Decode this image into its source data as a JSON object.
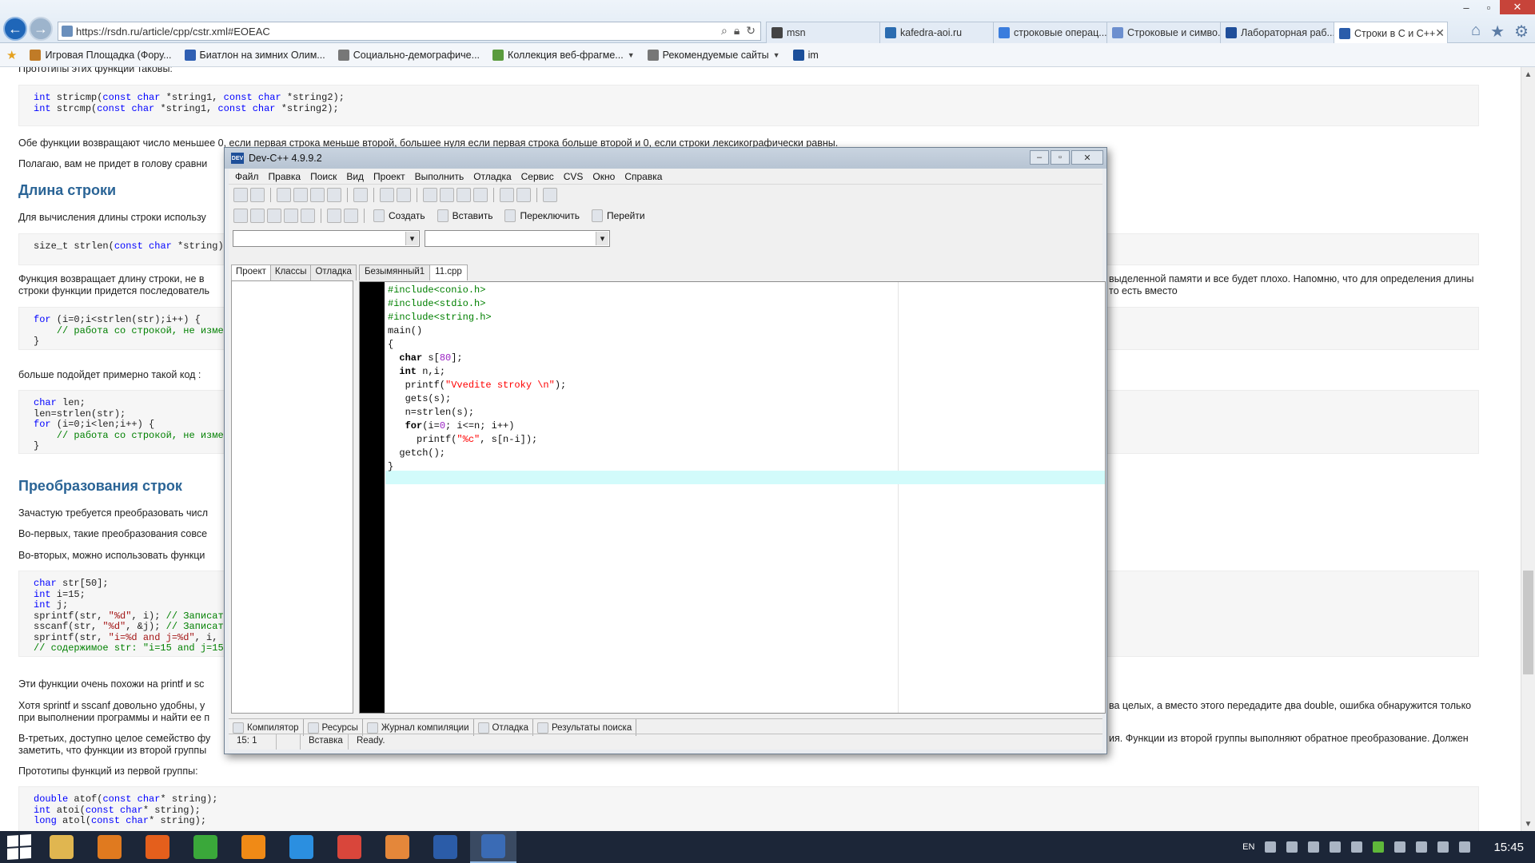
{
  "browser": {
    "url": "https://rsdn.ru/article/cpp/cstr.xml#EOEAC",
    "tabs": [
      {
        "label": "msn",
        "color": "#444"
      },
      {
        "label": "kafedra-aoi.ru",
        "color": "#2b6cb0"
      },
      {
        "label": "строковые операц...",
        "color": "#3b7ddd"
      },
      {
        "label": "Строковые и симво...",
        "color": "#6c8fcf"
      },
      {
        "label": "Лабораторная раб...",
        "color": "#1f4e9a"
      },
      {
        "label": "Строки в С и С++",
        "color": "#2a5caa",
        "active": true
      }
    ],
    "close_tab": "✕",
    "favorites": [
      {
        "label": "Игровая Площадка (Фору...",
        "color": "#c07b27"
      },
      {
        "label": "Биатлон на зимних Олим...",
        "color": "#2f5fb3"
      },
      {
        "label": "Социально-демографиче...",
        "color": "#777"
      },
      {
        "label": "Коллекция веб-фрагме...",
        "color": "#5a9b3d",
        "dropdown": true
      },
      {
        "label": "Рекомендуемые сайты",
        "color": "#777",
        "dropdown": true
      },
      {
        "label": "im",
        "color": "#1b4f9a"
      }
    ],
    "fav_star": "★"
  },
  "article": {
    "p_prototypes": "Прототипы этих функций таковы:",
    "code1": [
      [
        {
          "t": "int",
          "k": "kw"
        },
        {
          "t": " stricmp("
        },
        {
          "t": "const",
          "k": "kw"
        },
        {
          "t": " "
        },
        {
          "t": "char",
          "k": "kw"
        },
        {
          "t": " *string1, "
        },
        {
          "t": "const",
          "k": "kw"
        },
        {
          "t": " "
        },
        {
          "t": "char",
          "k": "kw"
        },
        {
          "t": " *string2);"
        }
      ],
      [
        {
          "t": "int",
          "k": "kw"
        },
        {
          "t": " strcmp("
        },
        {
          "t": "const",
          "k": "kw"
        },
        {
          "t": " "
        },
        {
          "t": "char",
          "k": "kw"
        },
        {
          "t": " *string1, "
        },
        {
          "t": "const",
          "k": "kw"
        },
        {
          "t": " "
        },
        {
          "t": "char",
          "k": "kw"
        },
        {
          "t": " *string2);"
        }
      ]
    ],
    "p_both": "Обе функции возвращают число меньшее 0, если первая строка меньше второй, большее нуля если первая строка больше второй и 0, если строки лексикографически равны.",
    "p_guess": "Полагаю, вам не придет в голову сравни",
    "h_length": "Длина строки",
    "p_length": "Для вычисления длины строки использу",
    "code2": [
      [
        {
          "t": "size_t strlen("
        },
        {
          "t": "const",
          "k": "kw"
        },
        {
          "t": " "
        },
        {
          "t": "char",
          "k": "kw"
        },
        {
          "t": " *string);"
        }
      ]
    ],
    "p_returns_a": "Функция возвращает длину строки, не в",
    "p_returns_a_right": "выделенной памяти и все будет плохо. Напомню, что для определения длины",
    "p_returns_b": "строки функции придется последователь",
    "p_returns_b_right": "то есть вместо",
    "code3": [
      [
        {
          "t": "for",
          "k": "kw"
        },
        {
          "t": " (i=0;i<strlen(str);i++) {"
        }
      ],
      [
        {
          "t": "    "
        },
        {
          "t": "// работа со строкой, не изме",
          "k": "cm"
        }
      ],
      [
        {
          "t": "}"
        }
      ]
    ],
    "p_better": "больше подойдет примерно такой код :",
    "code4": [
      [
        {
          "t": "char",
          "k": "kw"
        },
        {
          "t": " len;"
        }
      ],
      [
        {
          "t": "len=strlen(str);"
        }
      ],
      [
        {
          "t": "for",
          "k": "kw"
        },
        {
          "t": " (i=0;i<len;i++) {"
        }
      ],
      [
        {
          "t": "    "
        },
        {
          "t": "// работа со строкой, не изме",
          "k": "cm"
        }
      ],
      [
        {
          "t": "}"
        }
      ]
    ],
    "h_convert": "Преобразования строк",
    "p_often": "Зачастую требуется преобразовать числ",
    "p_first": "Во-первых, такие преобразования совсе",
    "p_second": "Во-вторых, можно использовать функци",
    "code5": [
      [
        {
          "t": "char",
          "k": "kw"
        },
        {
          "t": " str[50];"
        }
      ],
      [
        {
          "t": "int",
          "k": "kw"
        },
        {
          "t": " i=15;"
        }
      ],
      [
        {
          "t": "int",
          "k": "kw"
        },
        {
          "t": " j;"
        }
      ],
      [
        {
          "t": "sprintf(str, "
        },
        {
          "t": "\"%d\"",
          "k": "st"
        },
        {
          "t": ", i); "
        },
        {
          "t": "// Записат",
          "k": "cm"
        }
      ],
      [
        {
          "t": "sscanf(str, "
        },
        {
          "t": "\"%d\"",
          "k": "st"
        },
        {
          "t": ", &j); "
        },
        {
          "t": "// Записат",
          "k": "cm"
        }
      ],
      [
        {
          "t": "sprintf(str, "
        },
        {
          "t": "\"i=%d and j=%d\"",
          "k": "st"
        },
        {
          "t": ", i,"
        }
      ],
      [
        {
          "t": "// содержимое str: \"i=15 and j=15",
          "k": "cm"
        }
      ]
    ],
    "p_similar": "Эти функции очень похожи на printf и sc",
    "p_though_a": "Хотя sprintf и sscanf довольно удобны, у",
    "p_though_a_right": "ва целых, а вместо этого передадите два double, ошибка обнаружится только",
    "p_though_b": "при выполнении программы и найти ее п",
    "p_third_a": "В-третьих, доступно целое семейство фу",
    "p_third_a_right": "ия. Функции из второй группы выполняют обратное преобразование. Должен",
    "p_third_b": "заметить, что функции из второй группы",
    "p_protos_first": "Прототипы функций из первой группы:",
    "code6": [
      [
        {
          "t": "double",
          "k": "kw"
        },
        {
          "t": " atof("
        },
        {
          "t": "const",
          "k": "kw"
        },
        {
          "t": " "
        },
        {
          "t": "char",
          "k": "kw"
        },
        {
          "t": "* string);"
        }
      ],
      [
        {
          "t": "int",
          "k": "kw"
        },
        {
          "t": " atoi("
        },
        {
          "t": "const",
          "k": "kw"
        },
        {
          "t": " "
        },
        {
          "t": "char",
          "k": "kw"
        },
        {
          "t": "* string);"
        }
      ],
      [
        {
          "t": "long",
          "k": "kw"
        },
        {
          "t": " atol("
        },
        {
          "t": "const",
          "k": "kw"
        },
        {
          "t": " "
        },
        {
          "t": "char",
          "k": "kw"
        },
        {
          "t": "* string);"
        }
      ]
    ]
  },
  "devcpp": {
    "title": "Dev-C++ 4.9.9.2",
    "logo": "DEV",
    "menu": [
      "Файл",
      "Правка",
      "Поиск",
      "Вид",
      "Проект",
      "Выполнить",
      "Отладка",
      "Сервис",
      "CVS",
      "Окно",
      "Справка"
    ],
    "buttons": {
      "create": "Создать",
      "insert": "Вставить",
      "toggle": "Переключить",
      "goto": "Перейти"
    },
    "left_tabs": [
      "Проект",
      "Классы",
      "Отладка"
    ],
    "editor_tabs": [
      "Безымянный1",
      "11.cpp"
    ],
    "code": [
      [
        {
          "t": "#include<conio.h>",
          "k": "pp"
        }
      ],
      [
        {
          "t": "#include<stdio.h>",
          "k": "pp"
        }
      ],
      [
        {
          "t": "#include<string.h>",
          "k": "pp"
        }
      ],
      [
        {
          "t": "main()"
        }
      ],
      [
        {
          "t": "{"
        }
      ],
      [
        {
          "t": "  "
        },
        {
          "t": "char",
          "k": "ks"
        },
        {
          "t": " s["
        },
        {
          "t": "80",
          "k": "num"
        },
        {
          "t": "];"
        }
      ],
      [
        {
          "t": "  "
        },
        {
          "t": "int",
          "k": "ks"
        },
        {
          "t": " n,i;"
        }
      ],
      [
        {
          "t": "   printf("
        },
        {
          "t": "\"Vvedite stroky \\n\"",
          "k": "str"
        },
        {
          "t": ");"
        }
      ],
      [
        {
          "t": "   gets(s);"
        }
      ],
      [
        {
          "t": "   n=strlen(s);"
        }
      ],
      [
        {
          "t": "   "
        },
        {
          "t": "for",
          "k": "ks"
        },
        {
          "t": "(i="
        },
        {
          "t": "0",
          "k": "num"
        },
        {
          "t": "; i<=n; i++)"
        }
      ],
      [
        {
          "t": "     printf("
        },
        {
          "t": "\"%c\"",
          "k": "str"
        },
        {
          "t": ", s[n-i]);"
        }
      ],
      [
        {
          "t": "  getch();"
        }
      ],
      [
        {
          "t": "}"
        }
      ]
    ],
    "bottom_tabs": [
      "Компилятор",
      "Ресурсы",
      "Журнал компиляции",
      "Отладка",
      "Результаты поиска"
    ],
    "status": {
      "pos": "15: 1",
      "mode": "Вставка",
      "state": "Ready."
    }
  },
  "taskbar": {
    "lang": "EN",
    "time": "15:45",
    "apps": [
      {
        "name": "explorer",
        "color": "#e0b650"
      },
      {
        "name": "media-player",
        "color": "#e07a1f"
      },
      {
        "name": "firefox",
        "color": "#e45f1c"
      },
      {
        "name": "a-app",
        "color": "#3aa83a"
      },
      {
        "name": "odnoklassniki",
        "color": "#f08a16"
      },
      {
        "name": "internet-explorer",
        "color": "#2b8fe0"
      },
      {
        "name": "chrome",
        "color": "#d9463b"
      },
      {
        "name": "notes",
        "color": "#e4873a"
      },
      {
        "name": "word",
        "color": "#2b5ca8"
      },
      {
        "name": "devcpp",
        "color": "#3a6bb5",
        "active": true
      }
    ]
  }
}
